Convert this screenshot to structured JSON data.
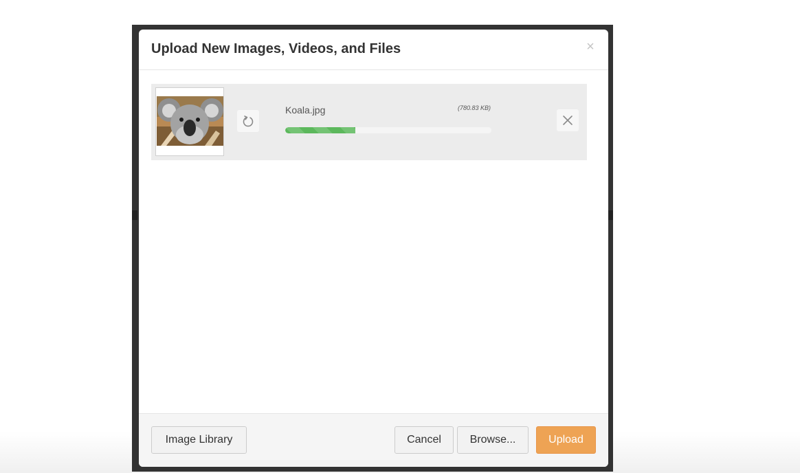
{
  "modal": {
    "title": "Upload New Images, Videos, and Files",
    "close_glyph": "×",
    "close_icon": "close-icon"
  },
  "file": {
    "name": "Koala.jpg",
    "size": "(780.83 KB)",
    "thumbnail_icon": "koala-photo",
    "progress_fraction": 0.34,
    "progress_color": "#5cb85c",
    "retry_icon": "refresh-icon",
    "remove_icon": "close-icon"
  },
  "footer": {
    "image_library_label": "Image Library",
    "cancel_label": "Cancel",
    "browse_label": "Browse...",
    "upload_label": "Upload",
    "upload_color": "#eea354"
  }
}
